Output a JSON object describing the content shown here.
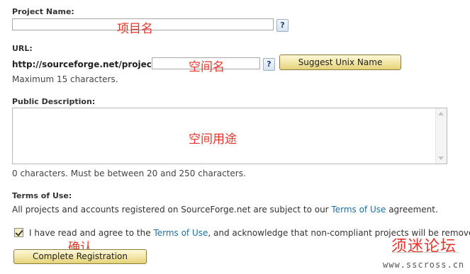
{
  "project_name": {
    "label": "Project Name:",
    "value": "",
    "help": "?",
    "annotation": "项目名"
  },
  "url": {
    "label": "URL:",
    "prefix": "http://sourceforge.net/projects/",
    "value": "",
    "help": "?",
    "annotation": "空间名",
    "suggest_button": "Suggest Unix Name",
    "hint": "Maximum 15 characters."
  },
  "description": {
    "label": "Public Description:",
    "value": "",
    "annotation": "空间用途",
    "hint": "0 characters. Must be between 20 and 250 characters."
  },
  "terms": {
    "label": "Terms of Use:",
    "text_before": "All projects and accounts registered on SourceForge.net are subject to our ",
    "link": "Terms of Use",
    "text_after": " agreement."
  },
  "agree": {
    "checked": true,
    "text_before": "I have read and agree to the ",
    "link": "Terms of Use",
    "text_after": ", and acknowledge that non-compliant projects will be removed."
  },
  "submit": {
    "label": "Complete Registration",
    "annotation": "确认"
  },
  "watermark": {
    "title": "须迷论坛",
    "url": "www.sscross.cn"
  },
  "colors": {
    "annotation_red": "#e8342a",
    "link_blue": "#1a6fa6",
    "button_gold": "#f3e7a9"
  }
}
